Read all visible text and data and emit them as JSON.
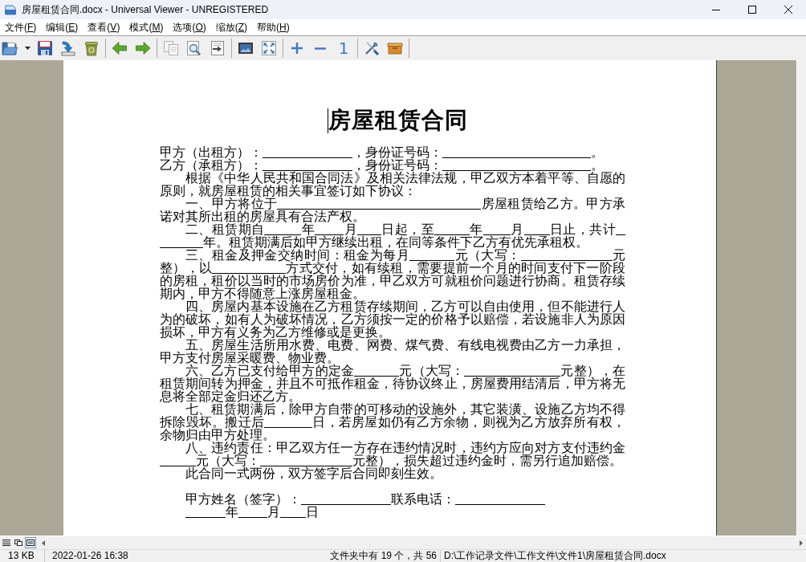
{
  "window": {
    "title": "房屋租赁合同.docx - Universal Viewer - UNREGISTERED"
  },
  "menu": [
    {
      "label": "文件(F)"
    },
    {
      "label": "编辑(E)"
    },
    {
      "label": "查看(V)"
    },
    {
      "label": "模式(M)"
    },
    {
      "label": "选项(O)"
    },
    {
      "label": "缩放(Z)"
    },
    {
      "label": "帮助(H)"
    }
  ],
  "toolbar": {
    "actual_size_label": "1"
  },
  "document": {
    "title": "房屋租赁合同",
    "paragraphs": [
      {
        "kind": "party",
        "lines": [
          [
            {
              "kind": "text",
              "text": "甲方（出租方）："
            },
            {
              "kind": "blank"
            },
            {
              "kind": "text",
              "text": "，身份证号码："
            },
            {
              "kind": "blank"
            },
            {
              "kind": "text",
              "text": "。"
            }
          ]
        ]
      },
      {
        "kind": "party",
        "lines": [
          [
            {
              "kind": "text",
              "text": "乙方（承租方）："
            },
            {
              "kind": "blank"
            },
            {
              "kind": "text",
              "text": "，身份证号码："
            },
            {
              "kind": "blank"
            },
            {
              "kind": "text",
              "text": "。"
            }
          ]
        ]
      },
      {
        "kind": "clause",
        "lines": [
          [
            {
              "kind": "text",
              "text": "根据《中华人民共和国合同法》及相关法律法规，甲乙双方本着平等、自愿的"
            }
          ],
          [
            {
              "kind": "text",
              "text": "原则，就房屋租赁的相关事宜签订如下协议："
            }
          ]
        ]
      },
      {
        "kind": "clause",
        "lines": [
          [
            {
              "kind": "text",
              "text": "一、甲方将位于"
            },
            {
              "kind": "blank"
            },
            {
              "kind": "text",
              "text": "房屋租赁给乙方。甲方承"
            }
          ],
          [
            {
              "kind": "text",
              "text": "诺对其所出租的房屋具有合法产权。"
            }
          ]
        ]
      },
      {
        "kind": "clause",
        "lines": [
          [
            {
              "kind": "text",
              "text": "二、租赁期自"
            },
            {
              "kind": "blank"
            },
            {
              "kind": "text",
              "text": "年"
            },
            {
              "kind": "blank"
            },
            {
              "kind": "text",
              "text": "月"
            },
            {
              "kind": "blank"
            },
            {
              "kind": "text",
              "text": "日起，至"
            },
            {
              "kind": "blank"
            },
            {
              "kind": "text",
              "text": "年"
            },
            {
              "kind": "blank"
            },
            {
              "kind": "text",
              "text": "月"
            },
            {
              "kind": "blank"
            },
            {
              "kind": "text",
              "text": "日止，共计"
            },
            {
              "kind": "blank"
            }
          ],
          [
            {
              "kind": "blank"
            },
            {
              "kind": "text",
              "text": "年。租赁期满后如甲方继续出租，在同等条件下乙方有优先承租权。"
            }
          ]
        ]
      },
      {
        "kind": "clause",
        "lines": [
          [
            {
              "kind": "text",
              "text": "三、租金及押金交纳时间：租金为每月"
            },
            {
              "kind": "blank"
            },
            {
              "kind": "text",
              "text": "元（大写："
            },
            {
              "kind": "blank"
            },
            {
              "kind": "text",
              "text": "元"
            }
          ],
          [
            {
              "kind": "text",
              "text": "整），以"
            },
            {
              "kind": "blank"
            },
            {
              "kind": "text",
              "text": "方式交付，如有续租，需要提前一个月的时间支付下一阶段"
            }
          ],
          [
            {
              "kind": "text",
              "text": "的房租，租价以当时的市场房价为准，甲乙双方可就租价问题进行协商。租赁存续"
            }
          ],
          [
            {
              "kind": "text",
              "text": "期内，甲方不得随意上涨房屋租金。"
            }
          ]
        ]
      },
      {
        "kind": "clause",
        "lines": [
          [
            {
              "kind": "text",
              "text": "四、房屋内基本设施在乙方租赁存续期间，乙方可以自由使用，但不能进行人"
            }
          ],
          [
            {
              "kind": "text",
              "text": "为的破坏，如有人为破坏情况，乙方须按一定的价格予以赔偿，若设施非人为原因"
            }
          ],
          [
            {
              "kind": "text",
              "text": "损坏，甲方有义务为乙方维修或是更换。"
            }
          ]
        ]
      },
      {
        "kind": "clause",
        "lines": [
          [
            {
              "kind": "text",
              "text": "五、房屋生活所用水费、电费、网费、煤气费、有线电视费由乙方一力承担，"
            }
          ],
          [
            {
              "kind": "text",
              "text": "甲方支付房屋采暖费、物业费。"
            }
          ]
        ]
      },
      {
        "kind": "clause",
        "lines": [
          [
            {
              "kind": "text",
              "text": "六、乙方已支付给甲方的定金"
            },
            {
              "kind": "blank"
            },
            {
              "kind": "text",
              "text": "元（大写："
            },
            {
              "kind": "blank"
            },
            {
              "kind": "text",
              "text": "元整），在"
            }
          ],
          [
            {
              "kind": "text",
              "text": "租赁期间转为押金，并且不可抵作租金，待协议终止，房屋费用结清后，甲方将无"
            }
          ],
          [
            {
              "kind": "text",
              "text": "息将全部定金归还乙方。"
            }
          ]
        ]
      },
      {
        "kind": "clause",
        "lines": [
          [
            {
              "kind": "text",
              "text": "七、租赁期满后，除甲方自带的可移动的设施外，其它装潢、设施乙方均不得"
            }
          ],
          [
            {
              "kind": "text",
              "text": "拆除毁坏。搬迁后"
            },
            {
              "kind": "blank"
            },
            {
              "kind": "text",
              "text": "日，若房屋如仍有乙方余物，则视为乙方放弃所有权，"
            }
          ],
          [
            {
              "kind": "text",
              "text": "余物归由甲方处理。"
            }
          ]
        ]
      },
      {
        "kind": "clause",
        "lines": [
          [
            {
              "kind": "text",
              "text": "八、违约责任：甲乙双方任一方存在违约情况时，违约方应向对方支付违约金"
            }
          ],
          [
            {
              "kind": "blank"
            },
            {
              "kind": "text",
              "text": "元（大写："
            },
            {
              "kind": "blank"
            },
            {
              "kind": "text",
              "text": "元整），损失超过违约金时，需另行追加赔偿。"
            }
          ]
        ]
      },
      {
        "kind": "clause",
        "lines": [
          [
            {
              "kind": "text",
              "text": "此合同一式两份，双方签字后合同即刻生效。"
            }
          ]
        ]
      },
      {
        "kind": "signature",
        "lines": [
          [
            {
              "kind": "text",
              "text": "甲方姓名（签字）："
            },
            {
              "kind": "blank"
            },
            {
              "kind": "text",
              "text": "联系电话："
            },
            {
              "kind": "blank"
            }
          ],
          [
            {
              "kind": "blank"
            },
            {
              "kind": "text",
              "text": "年"
            },
            {
              "kind": "blank"
            },
            {
              "kind": "text",
              "text": "月"
            },
            {
              "kind": "blank"
            },
            {
              "kind": "text",
              "text": "日"
            }
          ]
        ]
      }
    ]
  },
  "view_modes": [
    {
      "selected": false
    },
    {
      "selected": false
    },
    {
      "selected": true
    }
  ],
  "status_bar": {
    "size": "13 KB",
    "modified": "2022-01-26 16:38",
    "folder_position": "文件夹中有 19 个，共 56",
    "path": "D:\\工作记录文件\\工作文件\\文件1\\房屋租赁合同.docx"
  }
}
